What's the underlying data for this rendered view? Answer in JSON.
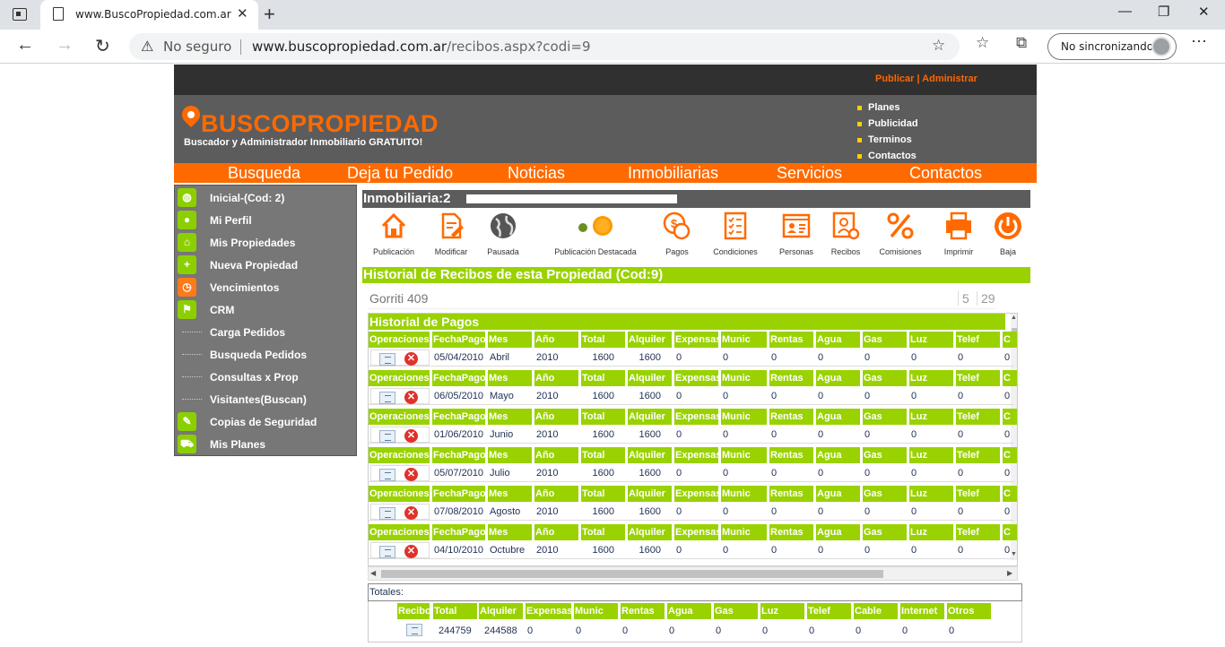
{
  "browser": {
    "tab_title": "www.BuscoPropiedad.com.ar",
    "address_security": "No seguro",
    "address_host": "www.buscopropiedad.com.ar",
    "address_path": "/recibos.aspx?codi=9",
    "sync_label": "No sincronizando"
  },
  "site": {
    "top_link": "Publicar | Administrar",
    "logo": "BUSCOPROPIEDAD",
    "tagline": "Buscador y Administrador  Inmobiliario GRATUITO!",
    "header_links": [
      "Planes",
      "Publicidad",
      "Terminos",
      "Contactos"
    ],
    "main_nav": [
      "Busqueda",
      "Deja tu Pedido",
      "Noticias",
      "Inmobiliarias",
      "Servicios",
      "Contactos"
    ],
    "accent_color": "#ff6a00",
    "green_color": "#99d200"
  },
  "sidebar": {
    "items": [
      {
        "label": "Inicial-(Cod: 2)",
        "icon": "globe-icon"
      },
      {
        "label": "Mi Perfil",
        "icon": "user-icon"
      },
      {
        "label": "Mis Propiedades",
        "icon": "home-icon"
      },
      {
        "label": "Nueva Propiedad",
        "icon": "plus-icon"
      },
      {
        "label": "Vencimientos",
        "icon": "clock-icon"
      },
      {
        "label": "CRM",
        "icon": "flag-icon"
      },
      {
        "label": "Carga Pedidos",
        "icon": "tree-branch"
      },
      {
        "label": "Busqueda Pedidos",
        "icon": "tree-branch"
      },
      {
        "label": "Consultas x Prop",
        "icon": "tree-branch"
      },
      {
        "label": "Visitantes(Buscan)",
        "icon": "tree-branch"
      },
      {
        "label": "Copias de Seguridad",
        "icon": "wrench-icon"
      },
      {
        "label": "Mis Planes",
        "icon": "cart-icon"
      }
    ]
  },
  "content": {
    "inmobiliaria_label": "Inmobiliaria:2",
    "actions": [
      {
        "label": "Publicación",
        "icon": "house-icon"
      },
      {
        "label": "Modificar",
        "icon": "edit-icon"
      },
      {
        "label": "Pausada",
        "icon": "globe-icon"
      },
      {
        "label": "Publicación Destacada",
        "icon": "star-badge-icon"
      },
      {
        "label": "Pagos",
        "icon": "coins-icon"
      },
      {
        "label": "Condiciones",
        "icon": "checklist-icon"
      },
      {
        "label": "Personas",
        "icon": "id-card-icon"
      },
      {
        "label": "Recibos",
        "icon": "receipt-icon"
      },
      {
        "label": "Comisiones",
        "icon": "percent-icon"
      },
      {
        "label": "Imprimir",
        "icon": "printer-icon"
      },
      {
        "label": "Baja",
        "icon": "power-icon"
      }
    ],
    "history_title": "Historial de Recibos de esta Propiedad (Cod:9)",
    "address": "Gorriti 409",
    "address_n1": "5",
    "address_n2": "29",
    "payments_title": "Historial de Pagos",
    "columns": [
      "Operaciones",
      "FechaPago",
      "Mes",
      "Año",
      "Total",
      "Alquiler",
      "Expensas",
      "Munic",
      "Rentas",
      "Agua",
      "Gas",
      "Luz",
      "Telef",
      "C"
    ],
    "records": [
      {
        "fecha": "05/04/2010",
        "mes": "Abril",
        "anio": "2010",
        "total": "1600",
        "alquiler": "1600",
        "rest": [
          "0",
          "0",
          "0",
          "0",
          "0",
          "0",
          "0",
          "0"
        ]
      },
      {
        "fecha": "06/05/2010",
        "mes": "Mayo",
        "anio": "2010",
        "total": "1600",
        "alquiler": "1600",
        "rest": [
          "0",
          "0",
          "0",
          "0",
          "0",
          "0",
          "0",
          "0"
        ]
      },
      {
        "fecha": "01/06/2010",
        "mes": "Junio",
        "anio": "2010",
        "total": "1600",
        "alquiler": "1600",
        "rest": [
          "0",
          "0",
          "0",
          "0",
          "0",
          "0",
          "0",
          "0"
        ]
      },
      {
        "fecha": "05/07/2010",
        "mes": "Julio",
        "anio": "2010",
        "total": "1600",
        "alquiler": "1600",
        "rest": [
          "0",
          "0",
          "0",
          "0",
          "0",
          "0",
          "0",
          "0"
        ]
      },
      {
        "fecha": "07/08/2010",
        "mes": "Agosto",
        "anio": "2010",
        "total": "1600",
        "alquiler": "1600",
        "rest": [
          "0",
          "0",
          "0",
          "0",
          "0",
          "0",
          "0",
          "0"
        ]
      },
      {
        "fecha": "04/10/2010",
        "mes": "Octubre",
        "anio": "2010",
        "total": "1600",
        "alquiler": "1600",
        "rest": [
          "0",
          "0",
          "0",
          "0",
          "0",
          "0",
          "0",
          "0"
        ]
      }
    ],
    "totales_label": "Totales:",
    "totals_columns": [
      "Recibo",
      "Total",
      "Alquiler",
      "Expensas",
      "Munic",
      "Rentas",
      "Agua",
      "Gas",
      "Luz",
      "Telef",
      "Cable",
      "Internet",
      "Otros"
    ],
    "totals_values": [
      "",
      "244759",
      "244588",
      "0",
      "0",
      "0",
      "0",
      "0",
      "0",
      "0",
      "0",
      "0",
      "0"
    ]
  }
}
